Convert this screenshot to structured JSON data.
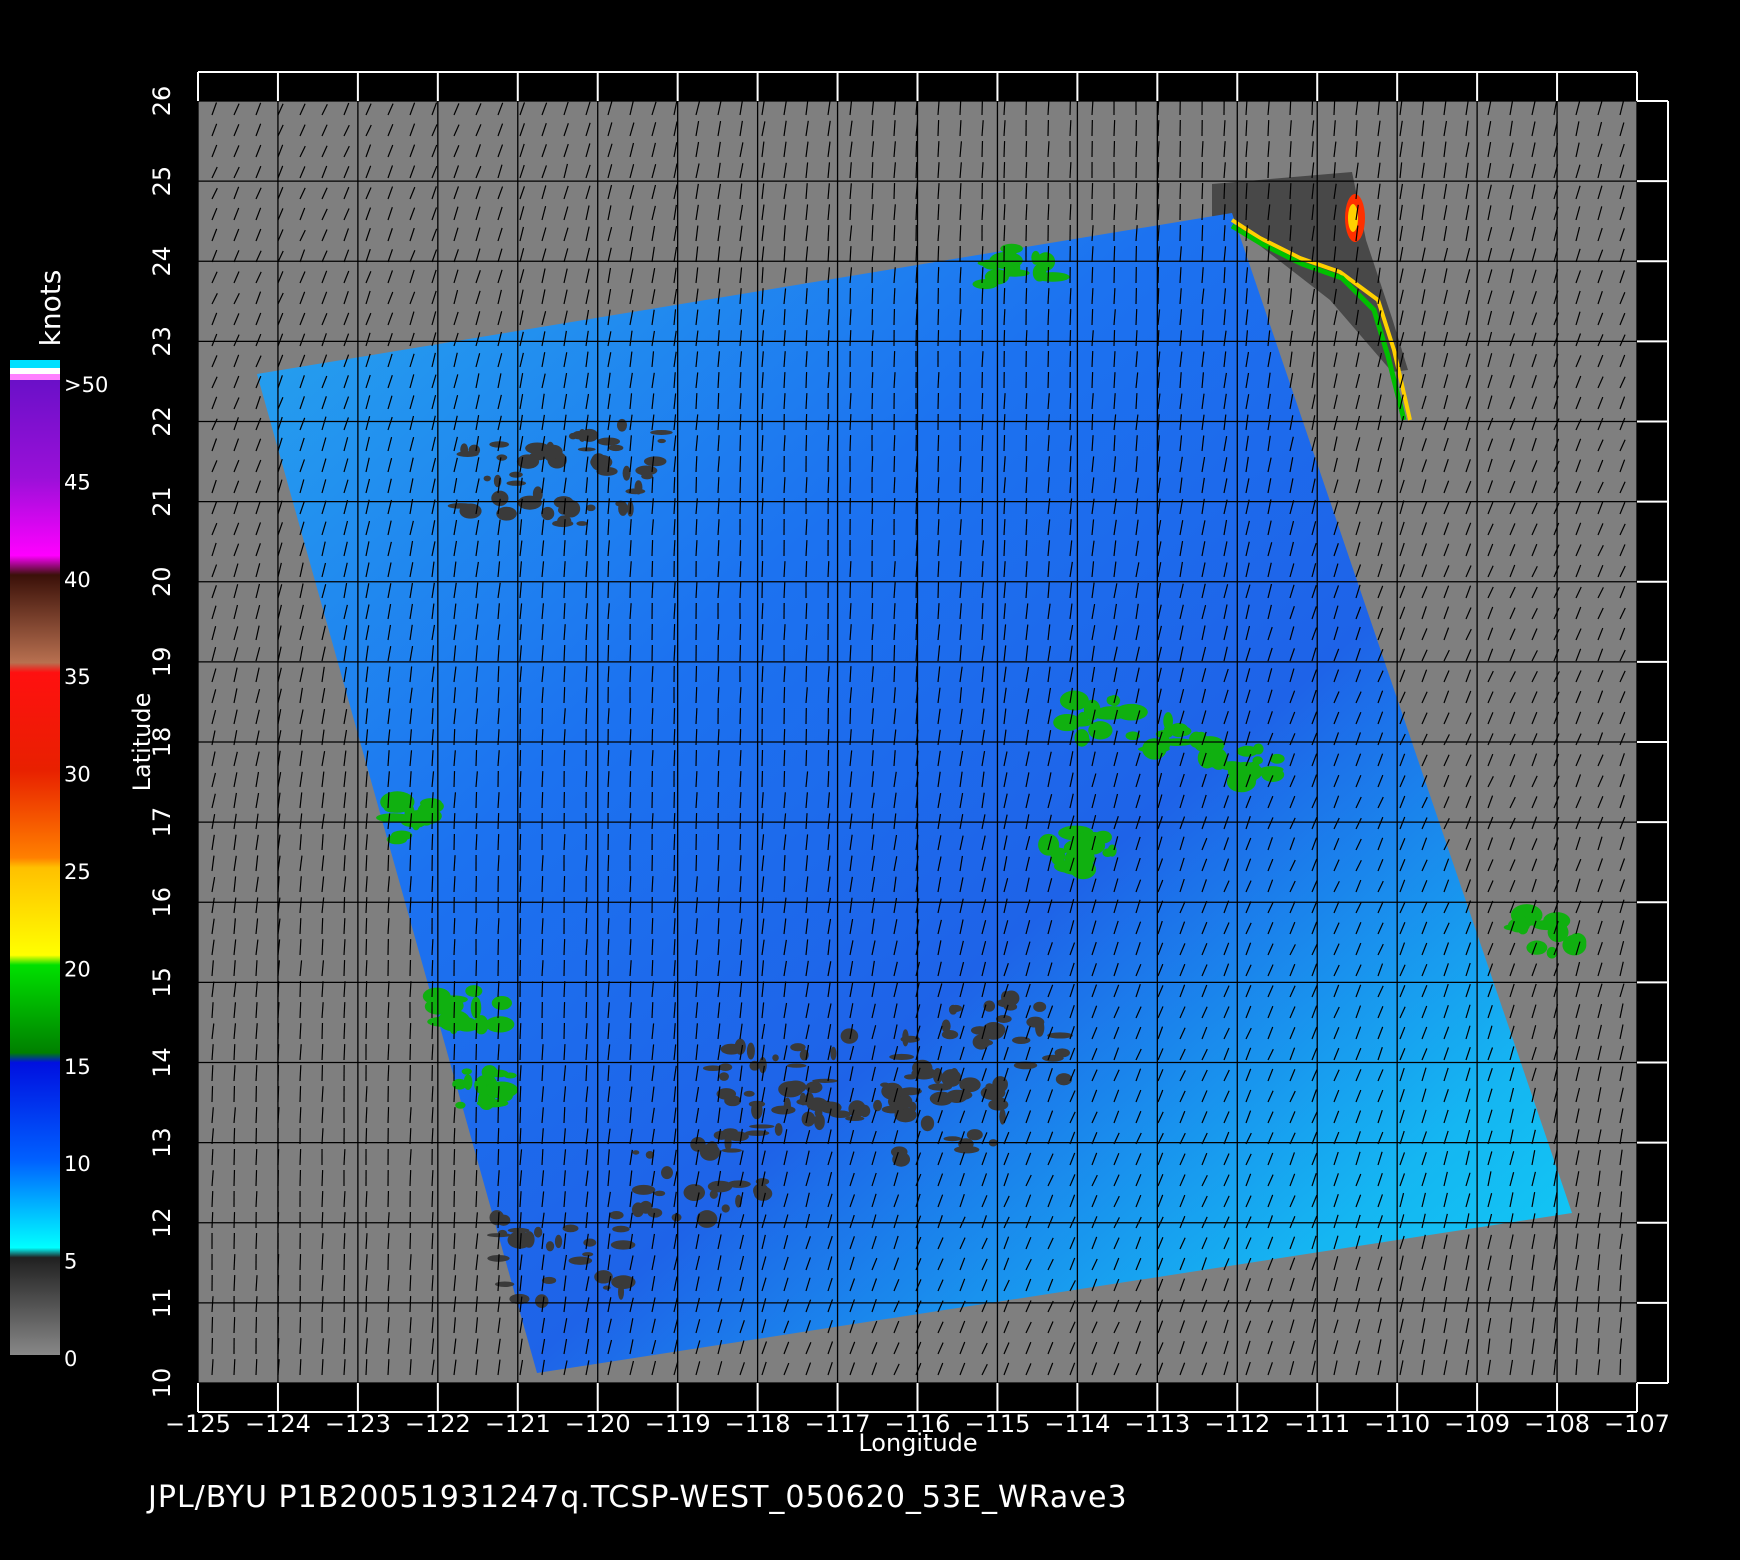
{
  "figure": {
    "colorbar_label": "knots",
    "colorbar_ticks": [
      ">50",
      "45",
      "40",
      "35",
      "30",
      "25",
      "20",
      "15",
      "10",
      "5",
      "0"
    ],
    "xlabel": "Longitude",
    "ylabel": "Latitude",
    "x_ticks": [
      "−125",
      "−124",
      "−123",
      "−122",
      "−121",
      "−120",
      "−119",
      "−118",
      "−117",
      "−116",
      "−115",
      "−114",
      "−113",
      "−112",
      "−111",
      "−110",
      "−109",
      "−108",
      "−107"
    ],
    "y_ticks": [
      "10",
      "11",
      "12",
      "13",
      "14",
      "15",
      "16",
      "17",
      "18",
      "19",
      "20",
      "21",
      "22",
      "23",
      "24",
      "25",
      "26"
    ],
    "footer": "JPL/BYU  P1B20051931247q.TCSP-WEST_050620_53E_WRave3"
  },
  "colors": {
    "background": "#000000",
    "land_mask": "#7f7f7f",
    "coast_land": "#4a4a4a",
    "scale": {
      "0": "#6f6f6f",
      "5": "#2f2f2f",
      "10": "#00e8ff",
      "15": "#0038ff",
      "20": "#00b400",
      "25": "#ffd400",
      "30": "#ff6a00",
      "35": "#ff1010",
      "40": "#6a2010",
      "45": "#ff00ff",
      "50": "#7a20c8"
    }
  }
}
